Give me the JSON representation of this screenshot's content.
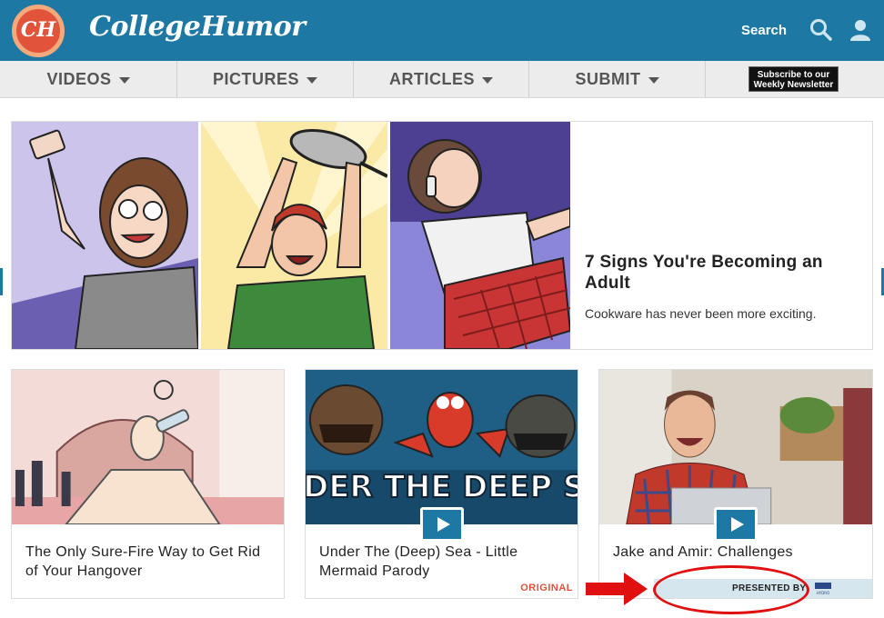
{
  "header": {
    "logo_mark": "CH",
    "logo_text": "CollegeHumor",
    "search_label": "Search"
  },
  "nav": {
    "items": [
      {
        "label": "VIDEOS"
      },
      {
        "label": "PICTURES"
      },
      {
        "label": "ARTICLES"
      },
      {
        "label": "SUBMIT"
      }
    ],
    "newsletter_line1": "Subscribe to our",
    "newsletter_line2": "Weekly Newsletter"
  },
  "feature": {
    "title": "7 Signs You're Becoming an Adult",
    "subtitle": "Cookware has never been more exciting."
  },
  "cards": [
    {
      "title": "The Only Sure-Fire Way to Get Rid of Your Hangover"
    },
    {
      "title": "Under The (Deep) Sea - Little Mermaid Parody",
      "badge": "ORIGINAL",
      "thumb_text": "UNDER THE DEEP SEA"
    },
    {
      "title": "Jake and Amir: Challenges",
      "sponsor_label": "PRESENTED BY",
      "sponsor_logo_text": "HYDRO"
    }
  ],
  "colors": {
    "brand_blue": "#1d79a3",
    "logo_orange": "#e2533b",
    "annotation_red": "#e01010"
  }
}
